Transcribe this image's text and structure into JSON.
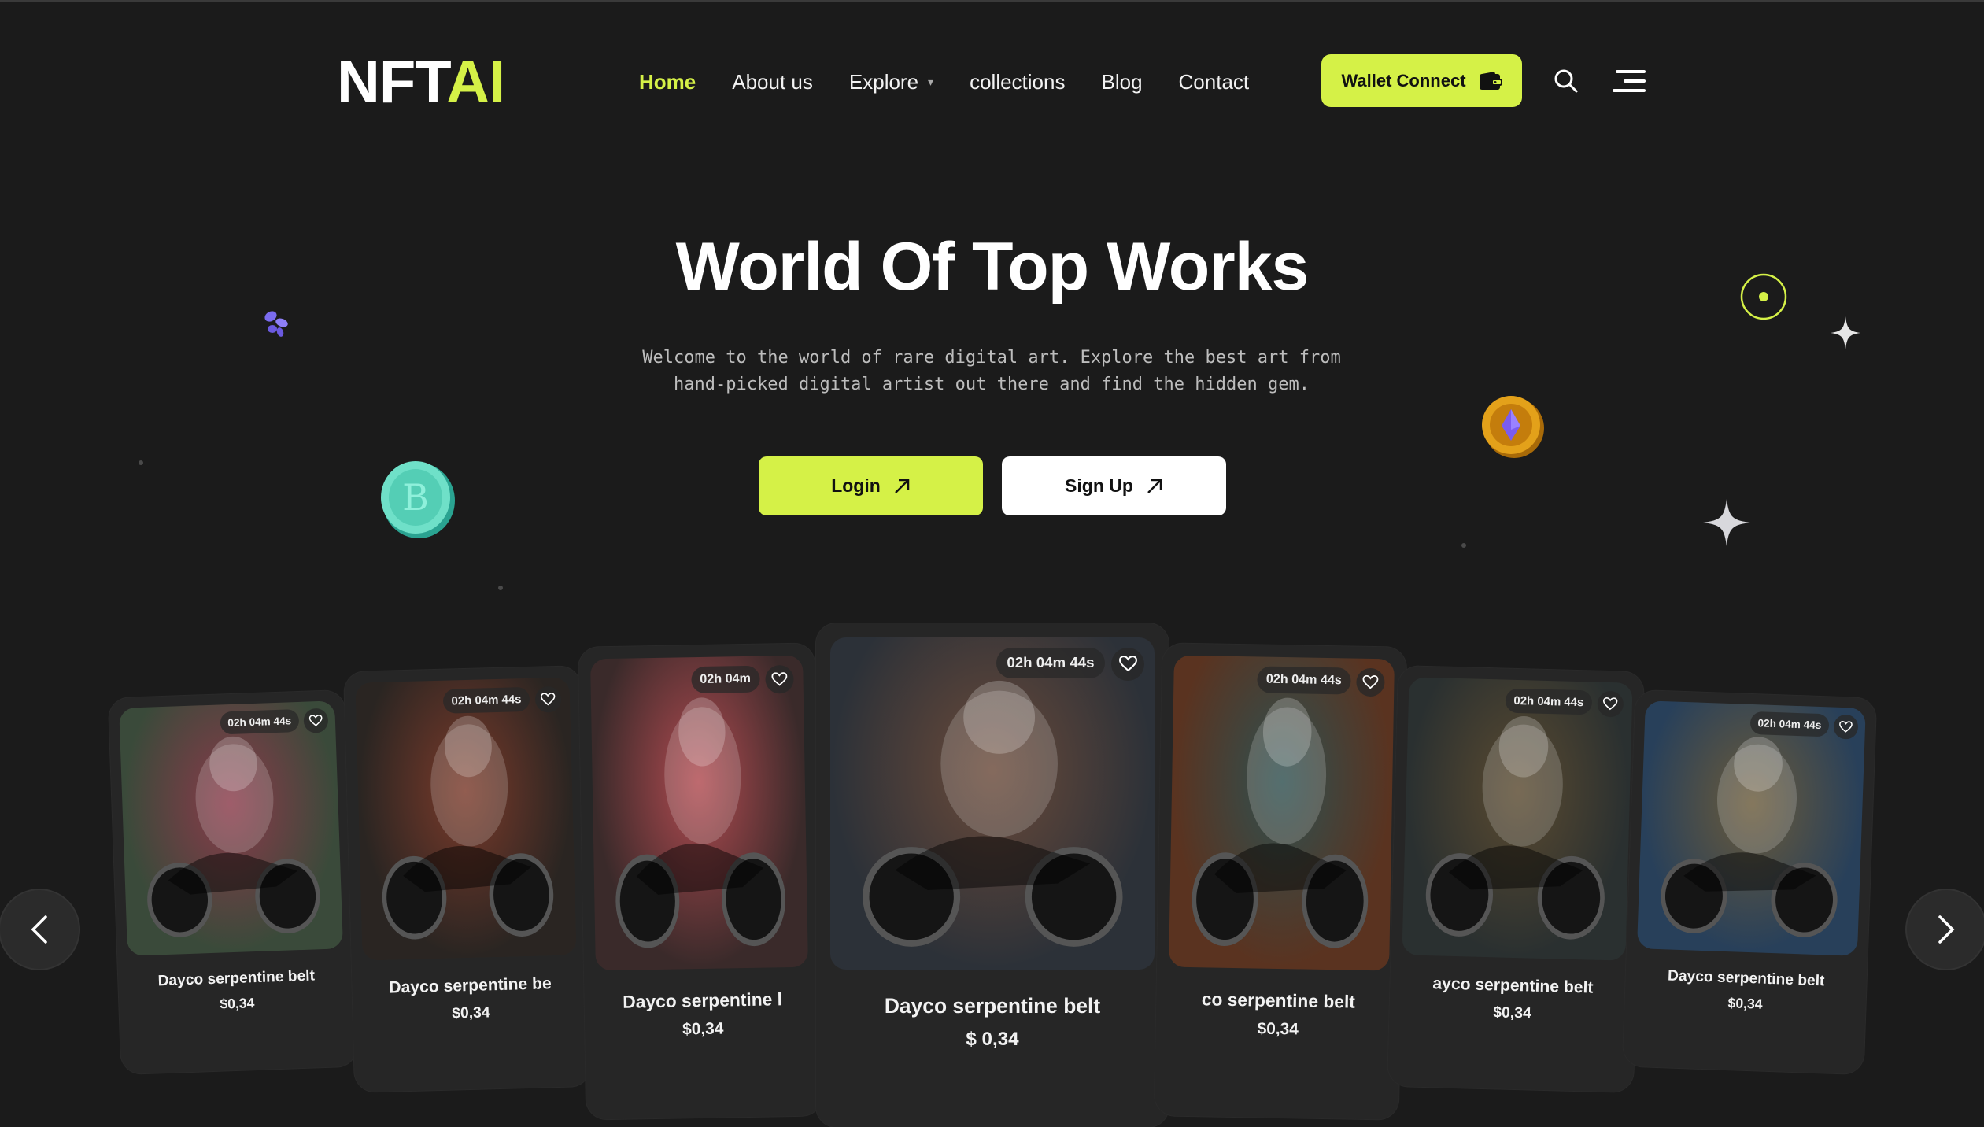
{
  "header": {
    "logo_main": "NFT",
    "logo_accent": "AI",
    "nav": {
      "home": "Home",
      "about": "About us",
      "explore": "Explore",
      "collections": "collections",
      "blog": "Blog",
      "contact": "Contact"
    },
    "wallet_label": "Wallet Connect"
  },
  "hero": {
    "title": "World Of Top Works",
    "subtitle_line1": "Welcome to the world of rare digital art. Explore the best art from",
    "subtitle_line2": "hand-picked digital artist out there and find the hidden gem.",
    "login_label": "Login",
    "signup_label": "Sign Up"
  },
  "cards": [
    {
      "name": "Dayco serpentine belt",
      "price": "$0,34",
      "timer": "02h 04m 44s",
      "img_colors": [
        "#3a4a3a",
        "#8a3a4a"
      ]
    },
    {
      "name": "Dayco serpentine be",
      "price": "$0,34",
      "timer": "02h 04m 44s",
      "img_colors": [
        "#2a2522",
        "#7a3a2a"
      ]
    },
    {
      "name": "Dayco serpentine l",
      "price": "$0,34",
      "timer": "02h 04m",
      "img_colors": [
        "#3a2a2a",
        "#b04a50"
      ]
    },
    {
      "name": "Dayco serpentine belt",
      "price": "$ 0,34",
      "timer": "02h 04m 44s",
      "img_colors": [
        "#2c3138",
        "#6a4a3a"
      ]
    },
    {
      "name": "co serpentine belt",
      "price": "$0,34",
      "timer": "02h 04m 44s",
      "img_colors": [
        "#5a3320",
        "#2f5050"
      ]
    },
    {
      "name": "ayco serpentine belt",
      "price": "$0,34",
      "timer": "02h 04m 44s",
      "img_colors": [
        "#2a3030",
        "#5a4a30"
      ]
    },
    {
      "name": "Dayco serpentine belt",
      "price": "$0,34",
      "timer": "02h 04m 44s",
      "img_colors": [
        "#28405a",
        "#6a5a3a"
      ]
    }
  ],
  "colors": {
    "accent": "#d5f147",
    "background": "#1b1b1b",
    "card": "#262626"
  },
  "icons": {
    "wallet": "wallet-icon",
    "search": "search-icon",
    "menu": "menu-icon",
    "arrow": "arrow-up-right-icon",
    "heart": "heart-icon",
    "prev": "chevron-left-icon",
    "next": "chevron-right-icon",
    "bitcoin": "bitcoin-coin-icon",
    "ethereum": "ethereum-coin-icon"
  }
}
